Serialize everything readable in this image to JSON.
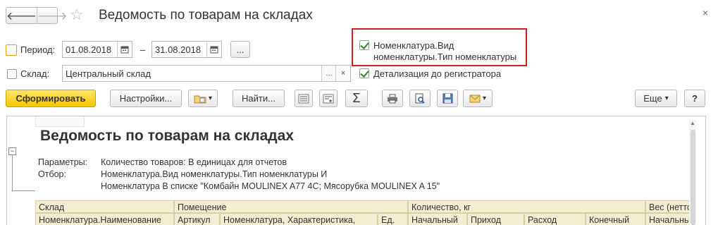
{
  "window": {
    "title": "Ведомость по товарам на складах",
    "close_glyph": "×",
    "back_glyph": "🡐",
    "forward_glyph": "🡒",
    "star_glyph": "☆"
  },
  "period": {
    "label": "Период:",
    "from": "01.08.2018",
    "to": "31.08.2018",
    "dash": "–",
    "more": "...",
    "checked": false
  },
  "warehouse": {
    "label": "Склад:",
    "value": "Центральный склад",
    "more": "...",
    "clear": "×",
    "checked": false
  },
  "options": {
    "nomenclature_type_line1": "Номенклатура.Вид",
    "nomenclature_type_line2": "номенклатуры.Тип номенклатуры",
    "nomenclature_type_checked": true,
    "register_detail": "Детализация до регистратора",
    "register_detail_checked": true
  },
  "toolbar": {
    "generate": "Сформировать",
    "settings": "Настройки...",
    "find": "Найти...",
    "sum_glyph": "Σ",
    "more": "Еще",
    "help": "?",
    "dropdown_glyph": "▾"
  },
  "report": {
    "title": "Ведомость по товарам на складах",
    "params_label": "Параметры:",
    "params_value": "Количество товаров: В единицах для отчетов",
    "filter_label": "Отбор:",
    "filter_value_1": "Номенклатура.Вид номенклатуры.Тип номенклатуры И",
    "filter_value_2": "Номенклатура В списке \"Комбайн MOULINEX  A77 4C; Мясорубка MOULINEX  A 15\"",
    "group_toggle": "−",
    "header_row1": [
      "Склад",
      "Помещение",
      "Количество, кг",
      "Вес (нетто),"
    ],
    "header_row2": [
      "Номенклатура.Наименование",
      "Артикул",
      "Номенклатура, Характеристика,",
      "Ед.",
      "Начальный",
      "Приход",
      "Расход",
      "Конечный",
      "Начальный"
    ]
  },
  "colors": {
    "accent_yellow": "#f4c800",
    "highlight_red": "#d02020",
    "header_bg": "#f4eed0",
    "check_green": "#2a8a2a"
  }
}
